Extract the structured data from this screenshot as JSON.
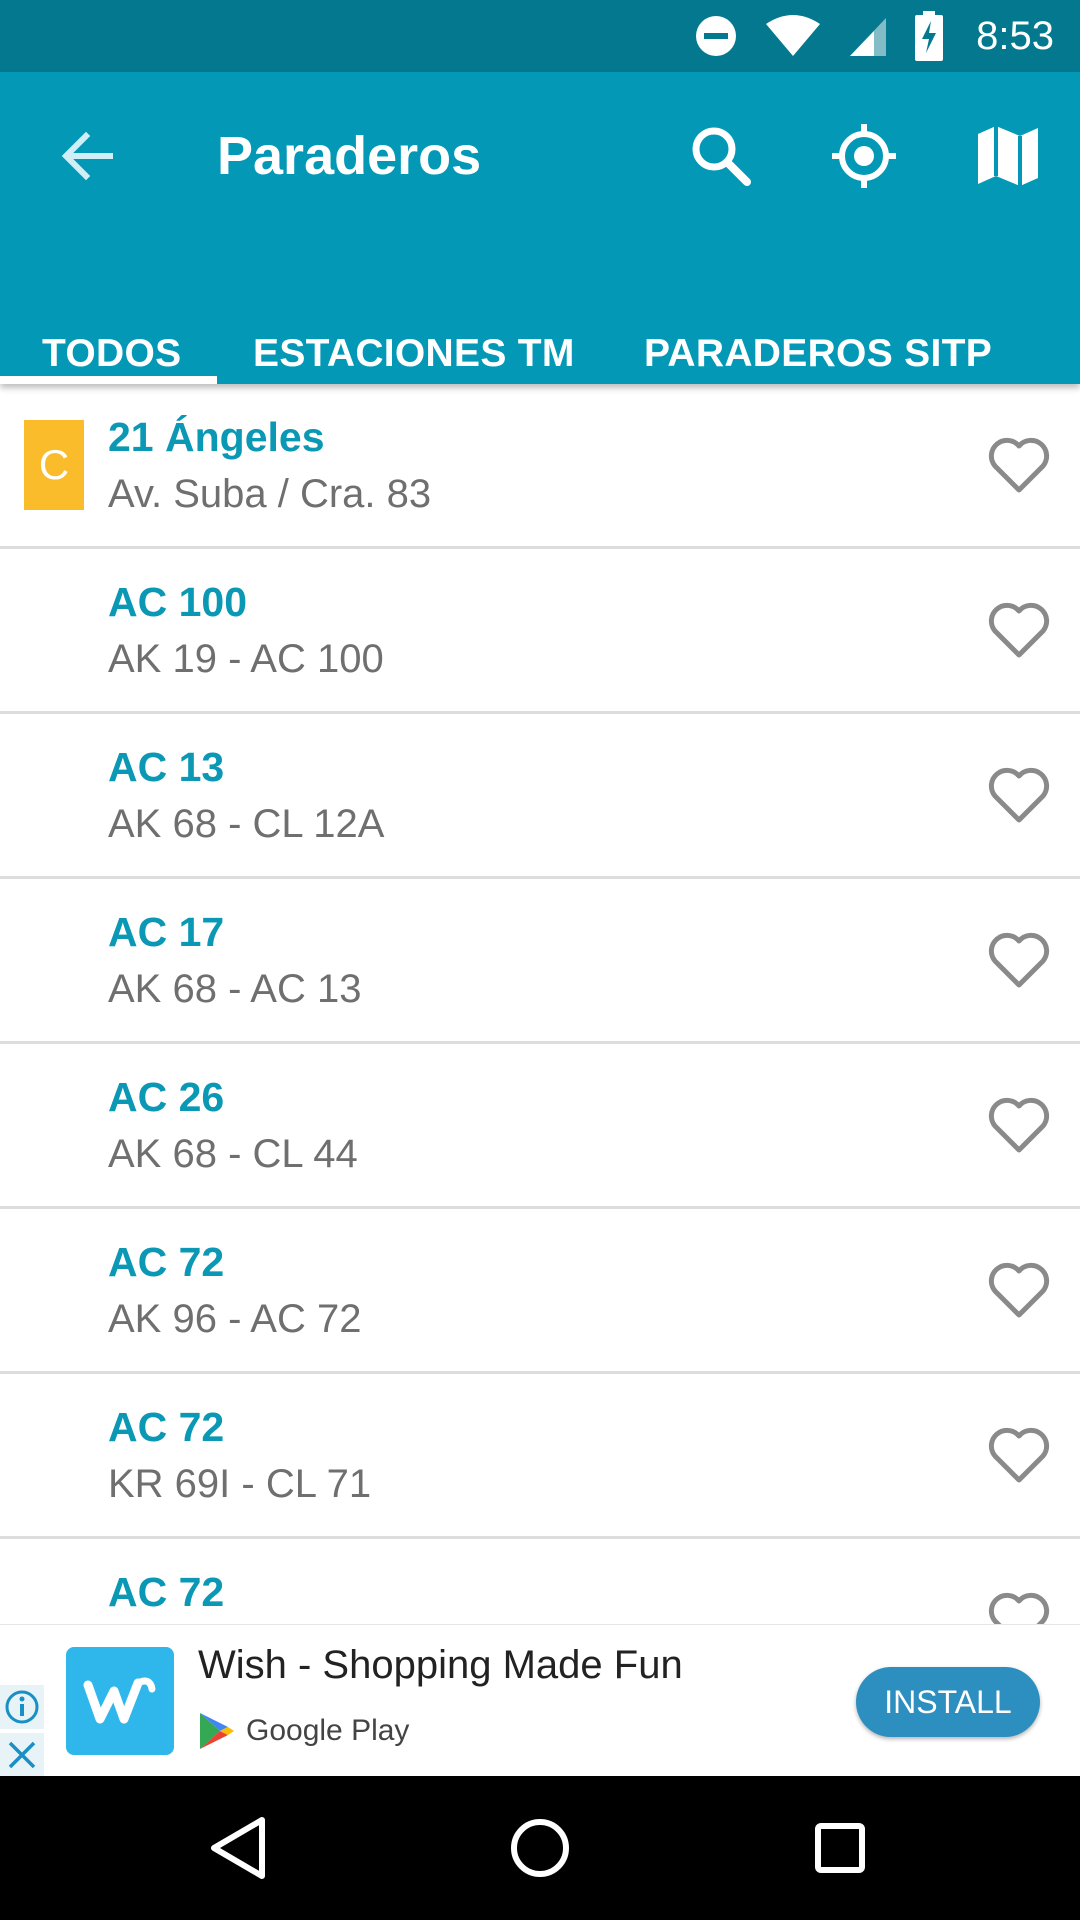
{
  "status_bar": {
    "time": "8:53",
    "icons": [
      "do-not-disturb-icon",
      "wifi-icon",
      "signal-icon",
      "battery-charging-icon"
    ]
  },
  "toolbar": {
    "title": "Paraderos",
    "back_icon": "arrow-back-icon",
    "actions": [
      "search-icon",
      "my-location-icon",
      "map-icon"
    ]
  },
  "tabs": [
    {
      "label": "TODOS",
      "selected": true
    },
    {
      "label": "ESTACIONES TM",
      "selected": false
    },
    {
      "label": "PARADEROS SITP",
      "selected": false
    }
  ],
  "list": {
    "items": [
      {
        "title": "21 Ángeles",
        "subtitle": "Av. Suba / Cra. 83",
        "badge": "C"
      },
      {
        "title": "AC 100",
        "subtitle": "AK 19 - AC 100"
      },
      {
        "title": "AC 13",
        "subtitle": "AK 68 - CL 12A"
      },
      {
        "title": "AC 17",
        "subtitle": "AK 68 - AC 13"
      },
      {
        "title": "AC 26",
        "subtitle": "AK 68 - CL 44"
      },
      {
        "title": "AC 72",
        "subtitle": "AK 96 - AC 72"
      },
      {
        "title": "AC 72",
        "subtitle": "KR 69I - CL 71"
      },
      {
        "title": "AC 72",
        "subtitle": ""
      }
    ],
    "favorite_icon": "heart-outline-icon"
  },
  "ad": {
    "title": "Wish - Shopping Made Fun",
    "store": "Google Play",
    "install_label": "INSTALL",
    "logo_letter": "w"
  },
  "colors": {
    "status_bar": "#03788f",
    "app_bar": "#0399b6",
    "title_text": "#0a98b5",
    "badge": "#fbbc2c",
    "install_button": "#2d8fc0"
  }
}
